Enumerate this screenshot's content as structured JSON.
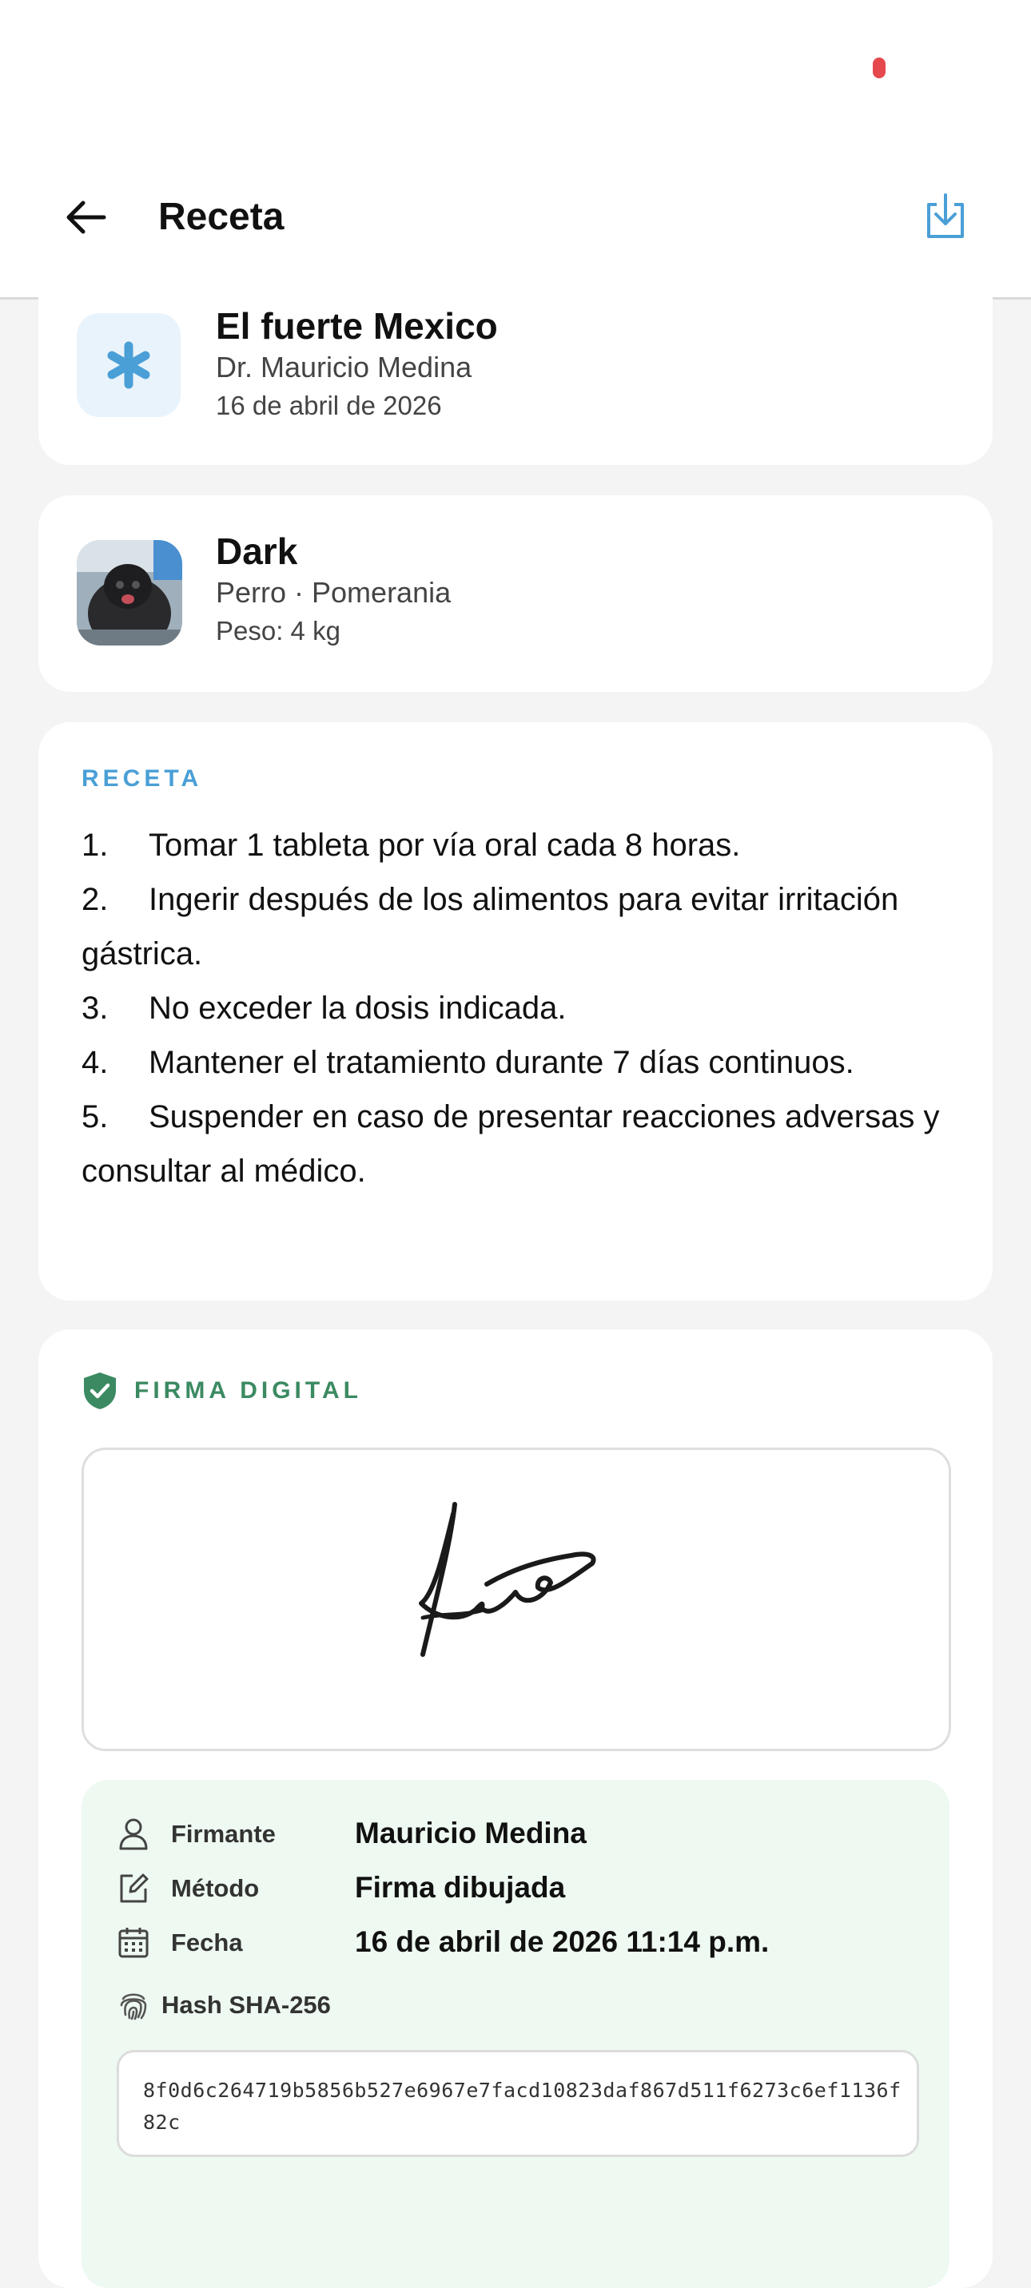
{
  "header": {
    "title": "Receta"
  },
  "clinic": {
    "name": "El fuerte Mexico",
    "doctor": "Dr. Mauricio Medina",
    "date": "16 de abril de 2026"
  },
  "pet": {
    "name": "Dark",
    "species_breed": "Perro · Pomerania",
    "weight": "Peso: 4 kg"
  },
  "recipe": {
    "label": "RECETA",
    "items": [
      {
        "num": "1.",
        "text": "Tomar 1 tableta por vía oral cada 8 horas."
      },
      {
        "num": "2.",
        "text": "Ingerir después de los alimentos para evitar irritación gástrica."
      },
      {
        "num": "3.",
        "text": "No exceder la dosis indicada."
      },
      {
        "num": "4.",
        "text": "Mantener el tratamiento durante 7 días continuos."
      },
      {
        "num": "5.",
        "text": "Suspender en caso de presentar reacciones adversas y consultar al médico."
      }
    ]
  },
  "signature": {
    "label": "FIRMA DIGITAL",
    "signer_key": "Firmante",
    "signer_value": "Mauricio Medina",
    "method_key": "Método",
    "method_value": "Firma dibujada",
    "date_key": "Fecha",
    "date_value": "16 de abril de 2026 11:14 p.m.",
    "hash_key": "Hash SHA-256",
    "hash_value": "8f0d6c264719b5856b527e6967e7facd10823daf867d511f6273c6ef1136f82c"
  },
  "colors": {
    "accent_blue": "#4a9fd6",
    "accent_green": "#3b8a62",
    "status_dot": "#e5484d",
    "meta_background": "#eef9f1"
  },
  "icons": {
    "back": "arrow-left-icon",
    "download": "download-icon",
    "clinic": "asterisk-icon",
    "shield": "shield-check-icon",
    "signer": "user-icon",
    "method": "pen-square-icon",
    "date": "calendar-icon",
    "hash": "fingerprint-icon"
  }
}
